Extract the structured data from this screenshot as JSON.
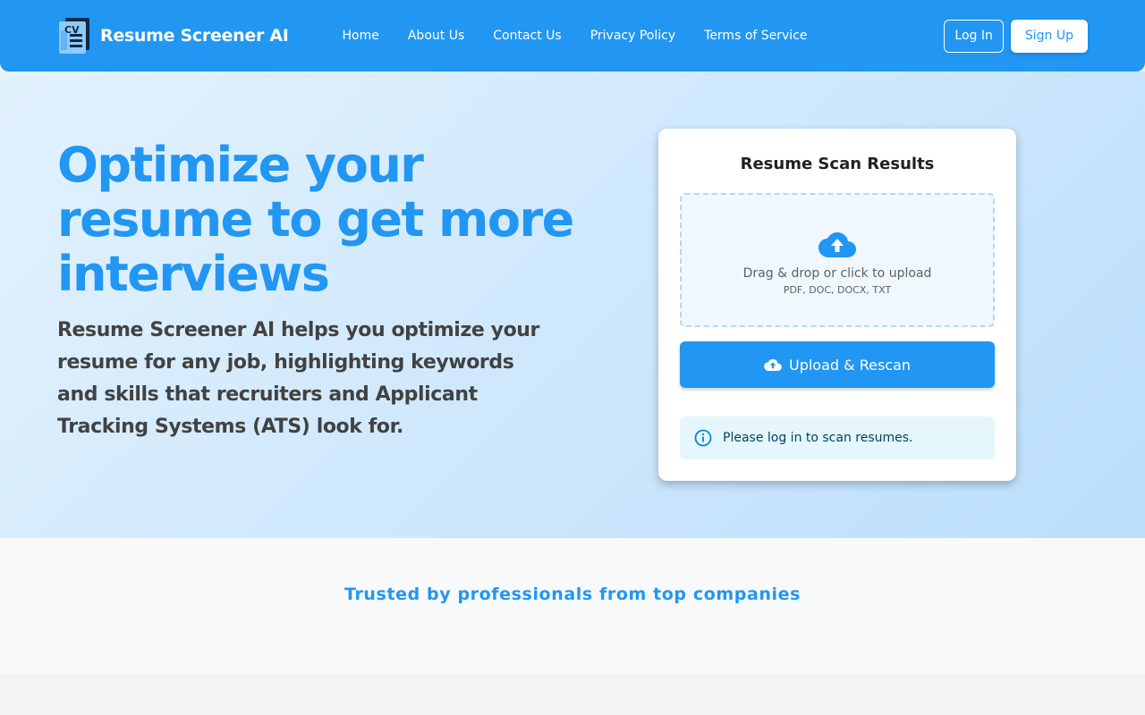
{
  "brand": {
    "name": "Resume Screener AI",
    "logo_text": "CV",
    "logo_icon": "resume-cv-icon"
  },
  "nav": {
    "links": [
      "Home",
      "About Us",
      "Contact Us",
      "Privacy Policy",
      "Terms of Service"
    ],
    "login_label": "Log In",
    "signup_label": "Sign Up"
  },
  "hero": {
    "title": "Optimize your resume to get more interviews",
    "description": "Resume Screener AI helps you optimize your resume for any job, highlighting keywords and skills that recruiters and Applicant Tracking Systems (ATS) look for."
  },
  "scan_card": {
    "title": "Resume Scan Results",
    "dropzone_icon": "cloud-upload-icon",
    "dropzone_text": "Drag & drop or click to upload",
    "dropzone_formats": "PDF, DOC, DOCX, TXT",
    "upload_button_label": "Upload & Rescan",
    "upload_button_icon": "cloud-upload-icon",
    "alert_icon": "info-icon",
    "alert_text": "Please log in to scan resumes."
  },
  "trusted": {
    "title": "Trusted by professionals from top companies"
  },
  "colors": {
    "primary": "#2196f3",
    "text_dark": "#424242",
    "alert_bg": "#e5f6fd",
    "alert_text": "#014361"
  }
}
